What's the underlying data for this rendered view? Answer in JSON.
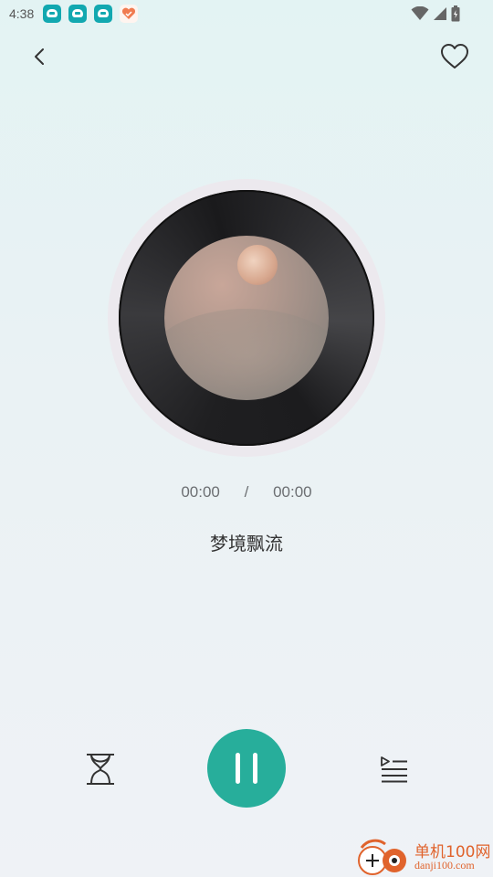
{
  "status_bar": {
    "time": "4:38",
    "notification_icons": [
      "app-notification-icon",
      "app-notification-icon",
      "app-notification-icon",
      "heart-app-icon"
    ],
    "right_icons": [
      "wifi-icon",
      "signal-icon",
      "battery-icon"
    ]
  },
  "header": {
    "back_icon": "chevron-left-icon",
    "favorite_icon": "heart-outline-icon"
  },
  "player": {
    "current_time": "00:00",
    "separator": "/",
    "total_time": "00:00",
    "track_title": "梦境飘流",
    "is_playing": true
  },
  "controls": {
    "timer_icon": "hourglass-icon",
    "play_pause_icon": "pause-icon",
    "playlist_icon": "playlist-icon"
  },
  "watermark": {
    "name": "单机100网",
    "url": "danji100.com"
  },
  "colors": {
    "accent": "#27ae9b",
    "watermark": "#e0632c",
    "notification": "#12a8b0"
  }
}
